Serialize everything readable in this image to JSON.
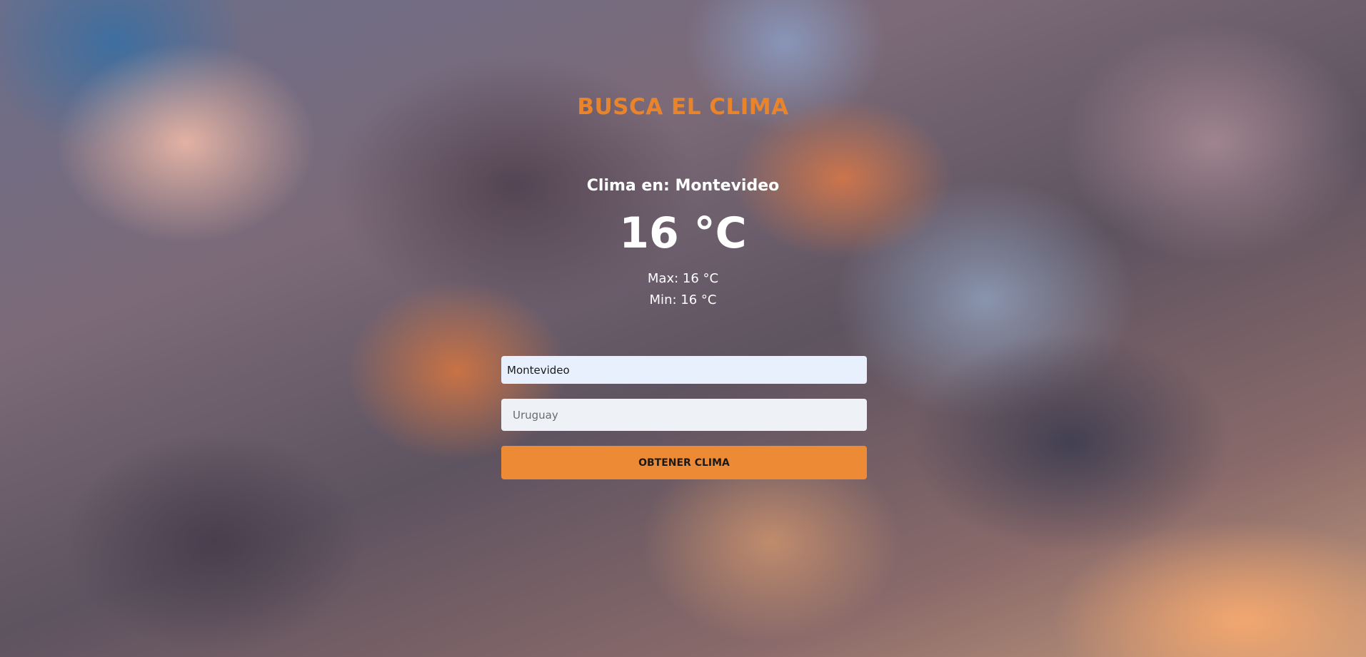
{
  "header": {
    "title": "BUSCA EL CLIMA"
  },
  "result": {
    "city_line": "Clima en: Montevideo",
    "temperature": "16 °C",
    "max": "Max: 16 °C",
    "min": "Min: 16 °C"
  },
  "form": {
    "city_value": "Montevideo",
    "country_placeholder": "Uruguay",
    "submit_label": "OBTENER CLIMA"
  },
  "colors": {
    "accent": "#e8852c",
    "button": "#ec8a35"
  }
}
